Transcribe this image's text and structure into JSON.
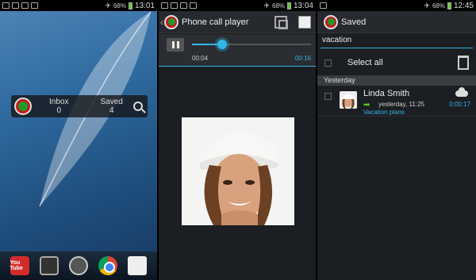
{
  "screen_home": {
    "status": {
      "battery": "68%",
      "time": "13:01"
    },
    "widget": {
      "inbox_label": "Inbox",
      "inbox_count": "0",
      "saved_label": "Saved",
      "saved_count": "4"
    },
    "dock": {
      "youtube_label": "You Tube"
    }
  },
  "screen_player": {
    "status": {
      "battery": "68%",
      "time": "13:04"
    },
    "title": "Phone call player",
    "player": {
      "position": "00:04",
      "duration": "00:16",
      "progress_fraction": 0.25
    }
  },
  "screen_saved": {
    "status": {
      "battery": "68%",
      "time": "12:45"
    },
    "title": "Saved",
    "search": {
      "value": "vacation"
    },
    "select_all_label": "Select all",
    "section_header": "Yesterday",
    "calls": [
      {
        "name": "Linda Smith",
        "time": "yesterday, 11:25",
        "note": "Vacation plans",
        "duration": "0:00:17"
      }
    ]
  },
  "colors": {
    "accent": "#33b5e5",
    "action_bar": "#26292d",
    "background": "#1b1e22",
    "call_arrow": "#5cd21b",
    "logo_red": "#c61a1a",
    "logo_green": "#1e9a2d"
  }
}
